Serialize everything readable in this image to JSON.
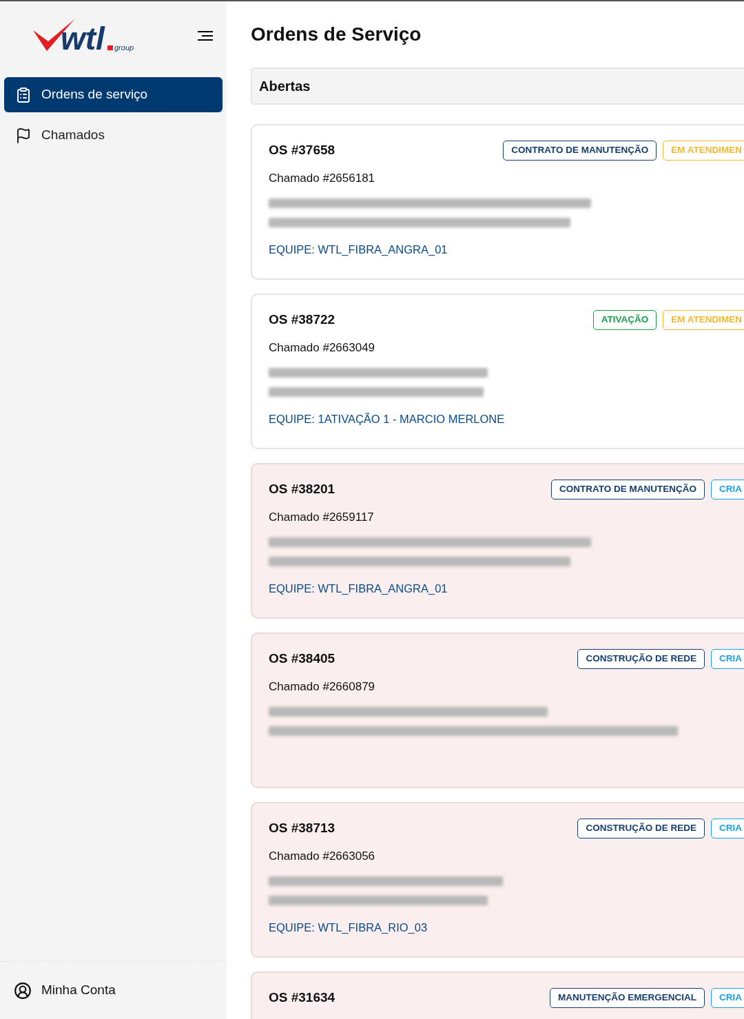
{
  "sidebar": {
    "logo": {
      "wordmark": "wtl",
      "suffix": "group"
    },
    "items": [
      {
        "label": "Ordens de serviço",
        "selected": true
      },
      {
        "label": "Chamados",
        "selected": false
      }
    ],
    "account": {
      "label": "Minha Conta"
    }
  },
  "page": {
    "title": "Ordens de Serviço",
    "section": "Abertas"
  },
  "orders": [
    {
      "title": "OS #37658",
      "ticket": "Chamado #2656181",
      "team": "EQUIPE: WTL_FIBRA_ANGRA_01",
      "highlighted": false,
      "tags": [
        {
          "label": "CONTRATO DE MANUTENÇÃO",
          "color": "#153e6e"
        },
        {
          "label": "EM ATENDIMEN",
          "color": "#f5b82e"
        }
      ]
    },
    {
      "title": "OS #38722",
      "ticket": "Chamado #2663049",
      "team": "EQUIPE: 1ATIVAÇÃO 1 - MARCIO MERLONE",
      "highlighted": false,
      "tags": [
        {
          "label": "ATIVAÇÃO",
          "color": "#16a34a"
        },
        {
          "label": "EM ATENDIMEN",
          "color": "#f5b82e"
        }
      ]
    },
    {
      "title": "OS #38201",
      "ticket": "Chamado #2659117",
      "team": "EQUIPE: WTL_FIBRA_ANGRA_01",
      "highlighted": true,
      "tags": [
        {
          "label": "CONTRATO DE MANUTENÇÃO",
          "color": "#153e6e"
        },
        {
          "label": "CRIA",
          "color": "#1ba1e6"
        }
      ]
    },
    {
      "title": "OS #38405",
      "ticket": "Chamado #2660879",
      "highlighted": true,
      "tags": [
        {
          "label": "CONSTRUÇÃO DE REDE",
          "color": "#153e6e"
        },
        {
          "label": "CRIA",
          "color": "#1ba1e6"
        }
      ]
    },
    {
      "title": "OS #38713",
      "ticket": "Chamado #2663056",
      "team": "EQUIPE: WTL_FIBRA_RIO_03",
      "highlighted": true,
      "tags": [
        {
          "label": "CONSTRUÇÃO DE REDE",
          "color": "#153e6e"
        },
        {
          "label": "CRIA",
          "color": "#1ba1e6"
        }
      ]
    },
    {
      "title": "OS #31634",
      "highlighted": true,
      "tags": [
        {
          "label": "MANUTENÇÃO EMERGENCIAL",
          "color": "#153e6e"
        },
        {
          "label": "CRIA",
          "color": "#1ba1e6"
        }
      ]
    }
  ]
}
